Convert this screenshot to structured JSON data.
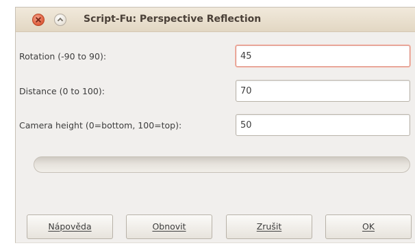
{
  "window": {
    "title": "Script-Fu: Perspective Reflection"
  },
  "fields": [
    {
      "label": "Rotation (-90 to 90):",
      "value": "45"
    },
    {
      "label": "Distance (0 to 100):",
      "value": "70"
    },
    {
      "label": "Camera height (0=bottom, 100=top):",
      "value": "50"
    }
  ],
  "progress": {
    "fraction": 0
  },
  "buttons": {
    "help": "Nápověda",
    "reset": "Obnovit",
    "cancel": "Zrušit",
    "ok": "OK"
  },
  "colors": {
    "close_button": "#e0603f",
    "titlebar": "#e2d7c3",
    "focus_border": "#e08a7a"
  }
}
